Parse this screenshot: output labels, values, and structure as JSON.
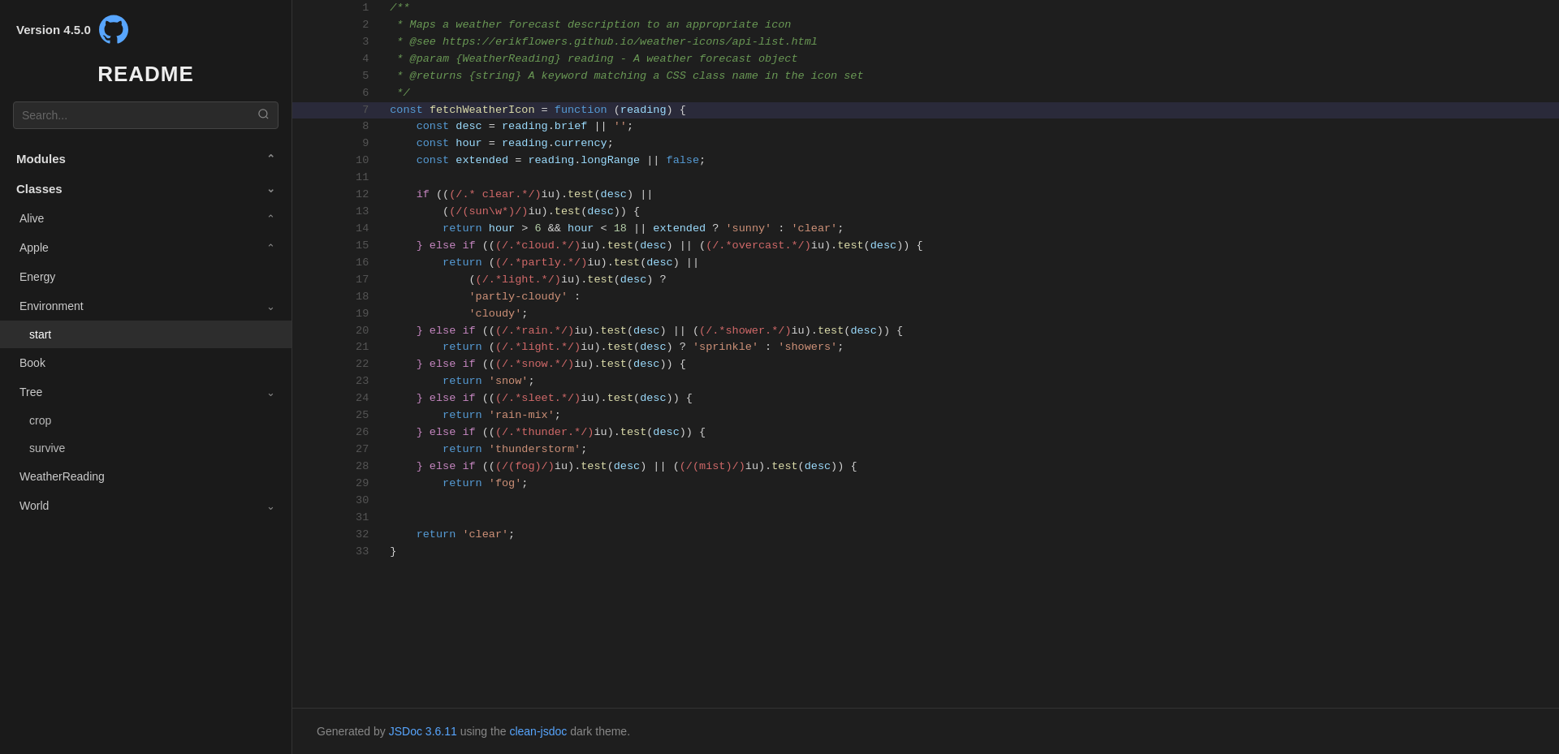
{
  "sidebar": {
    "version": "Version 4.5.0",
    "readme": "README",
    "search_placeholder": "Search...",
    "modules_label": "Modules",
    "classes_label": "Classes",
    "items": [
      {
        "label": "Alive",
        "expanded": true,
        "id": "alive"
      },
      {
        "label": "Apple",
        "expanded": true,
        "id": "apple"
      },
      {
        "label": "Energy",
        "expanded": false,
        "id": "energy"
      },
      {
        "label": "Environment",
        "expanded": false,
        "id": "environment"
      },
      {
        "label": "start",
        "expanded": false,
        "id": "start",
        "active": true
      },
      {
        "label": "Book",
        "expanded": false,
        "id": "book"
      },
      {
        "label": "Tree",
        "expanded": false,
        "id": "tree"
      },
      {
        "label": "crop",
        "expanded": false,
        "id": "crop",
        "sub": true
      },
      {
        "label": "survive",
        "expanded": false,
        "id": "survive",
        "sub": true
      },
      {
        "label": "WeatherReading",
        "expanded": false,
        "id": "weatherreading"
      },
      {
        "label": "World",
        "expanded": false,
        "id": "world"
      }
    ]
  },
  "footer": {
    "text_before": "Generated by ",
    "jsdoc_label": "JSDoc 3.6.11",
    "jsdoc_href": "#",
    "text_middle": " using the ",
    "theme_label": "clean-jsdoc",
    "theme_href": "#",
    "text_after": " dark theme."
  },
  "code": {
    "lines": [
      {
        "num": 1,
        "highlighted": false,
        "tokens": [
          {
            "t": "cm",
            "v": "/**"
          }
        ]
      },
      {
        "num": 2,
        "highlighted": false,
        "tokens": [
          {
            "t": "cm",
            "v": " * Maps a weather forecast description to an appropriate icon"
          }
        ]
      },
      {
        "num": 3,
        "highlighted": false,
        "tokens": [
          {
            "t": "cm",
            "v": " * @see https://erikflowers.github.io/weather-icons/api-list.html"
          }
        ]
      },
      {
        "num": 4,
        "highlighted": false,
        "tokens": [
          {
            "t": "cm",
            "v": " * @param {WeatherReading} reading - A weather forecast object"
          }
        ]
      },
      {
        "num": 5,
        "highlighted": false,
        "tokens": [
          {
            "t": "cm",
            "v": " * @returns {string} A keyword matching a CSS class name in the icon set"
          }
        ]
      },
      {
        "num": 6,
        "highlighted": false,
        "tokens": [
          {
            "t": "cm",
            "v": " */"
          }
        ]
      },
      {
        "num": 7,
        "highlighted": true,
        "tokens": [
          {
            "t": "kw",
            "v": "const "
          },
          {
            "t": "fn",
            "v": "fetchWeatherIcon"
          },
          {
            "t": "pn",
            "v": " = "
          },
          {
            "t": "kw",
            "v": "function "
          },
          {
            "t": "pn",
            "v": "("
          },
          {
            "t": "var",
            "v": "reading"
          },
          {
            "t": "pn",
            "v": ") {"
          }
        ]
      },
      {
        "num": 8,
        "highlighted": false,
        "tokens": [
          {
            "t": "pn",
            "v": "    "
          },
          {
            "t": "kw",
            "v": "const "
          },
          {
            "t": "var",
            "v": "desc"
          },
          {
            "t": "pn",
            "v": " = "
          },
          {
            "t": "var",
            "v": "reading"
          },
          {
            "t": "pn",
            "v": "."
          },
          {
            "t": "var",
            "v": "brief"
          },
          {
            "t": "pn",
            "v": " || "
          },
          {
            "t": "str",
            "v": "''"
          },
          {
            "t": "pn",
            "v": ";"
          }
        ]
      },
      {
        "num": 9,
        "highlighted": false,
        "tokens": [
          {
            "t": "pn",
            "v": "    "
          },
          {
            "t": "kw",
            "v": "const "
          },
          {
            "t": "var",
            "v": "hour"
          },
          {
            "t": "pn",
            "v": " = "
          },
          {
            "t": "var",
            "v": "reading"
          },
          {
            "t": "pn",
            "v": "."
          },
          {
            "t": "var",
            "v": "currency"
          },
          {
            "t": "pn",
            "v": ";"
          }
        ]
      },
      {
        "num": 10,
        "highlighted": false,
        "tokens": [
          {
            "t": "pn",
            "v": "    "
          },
          {
            "t": "kw",
            "v": "const "
          },
          {
            "t": "var",
            "v": "extended"
          },
          {
            "t": "pn",
            "v": " = "
          },
          {
            "t": "var",
            "v": "reading"
          },
          {
            "t": "pn",
            "v": "."
          },
          {
            "t": "var",
            "v": "longRange"
          },
          {
            "t": "pn",
            "v": " || "
          },
          {
            "t": "bool",
            "v": "false"
          },
          {
            "t": "pn",
            "v": ";"
          }
        ]
      },
      {
        "num": 11,
        "highlighted": false,
        "tokens": []
      },
      {
        "num": 12,
        "highlighted": false,
        "tokens": [
          {
            "t": "pn",
            "v": "    "
          },
          {
            "t": "kw2",
            "v": "if"
          },
          {
            "t": "pn",
            "v": " (("
          },
          {
            "t": "rx",
            "v": "(/.* clear.*/)"
          },
          {
            "t": "pn",
            "v": "iu)."
          },
          {
            "t": "fn",
            "v": "test"
          },
          {
            "t": "pn",
            "v": "("
          },
          {
            "t": "var",
            "v": "desc"
          },
          {
            "t": "pn",
            "v": ") ||"
          }
        ]
      },
      {
        "num": 13,
        "highlighted": false,
        "tokens": [
          {
            "t": "pn",
            "v": "        ("
          },
          {
            "t": "rx",
            "v": "(/(sun\\w*)/)"
          },
          {
            "t": "pn",
            "v": "iu)."
          },
          {
            "t": "fn",
            "v": "test"
          },
          {
            "t": "pn",
            "v": "("
          },
          {
            "t": "var",
            "v": "desc"
          },
          {
            "t": "pn",
            "v": ")) {"
          }
        ]
      },
      {
        "num": 14,
        "highlighted": false,
        "tokens": [
          {
            "t": "pn",
            "v": "        "
          },
          {
            "t": "kw",
            "v": "return "
          },
          {
            "t": "var",
            "v": "hour"
          },
          {
            "t": "pn",
            "v": " > "
          },
          {
            "t": "num",
            "v": "6"
          },
          {
            "t": "pn",
            "v": " && "
          },
          {
            "t": "var",
            "v": "hour"
          },
          {
            "t": "pn",
            "v": " < "
          },
          {
            "t": "num",
            "v": "18"
          },
          {
            "t": "pn",
            "v": " || "
          },
          {
            "t": "var",
            "v": "extended"
          },
          {
            "t": "pn",
            "v": " ? "
          },
          {
            "t": "str",
            "v": "'sunny'"
          },
          {
            "t": "pn",
            "v": " : "
          },
          {
            "t": "str",
            "v": "'clear'"
          },
          {
            "t": "pn",
            "v": ";"
          }
        ]
      },
      {
        "num": 15,
        "highlighted": false,
        "tokens": [
          {
            "t": "pn",
            "v": "    "
          },
          {
            "t": "kw2",
            "v": "} else if"
          },
          {
            "t": "pn",
            "v": " (("
          },
          {
            "t": "rx",
            "v": "(/.*cloud.*/)"
          },
          {
            "t": "pn",
            "v": "iu)."
          },
          {
            "t": "fn",
            "v": "test"
          },
          {
            "t": "pn",
            "v": "("
          },
          {
            "t": "var",
            "v": "desc"
          },
          {
            "t": "pn",
            "v": ") || ("
          },
          {
            "t": "rx",
            "v": "(/.*overcast.*/)"
          },
          {
            "t": "pn",
            "v": "iu)."
          },
          {
            "t": "fn",
            "v": "test"
          },
          {
            "t": "pn",
            "v": "("
          },
          {
            "t": "var",
            "v": "desc"
          },
          {
            "t": "pn",
            "v": ")) {"
          }
        ]
      },
      {
        "num": 16,
        "highlighted": false,
        "tokens": [
          {
            "t": "pn",
            "v": "        "
          },
          {
            "t": "kw",
            "v": "return "
          },
          {
            "t": "pn",
            "v": "("
          },
          {
            "t": "rx",
            "v": "(/.*partly.*/)"
          },
          {
            "t": "pn",
            "v": "iu)."
          },
          {
            "t": "fn",
            "v": "test"
          },
          {
            "t": "pn",
            "v": "("
          },
          {
            "t": "var",
            "v": "desc"
          },
          {
            "t": "pn",
            "v": ") ||"
          }
        ]
      },
      {
        "num": 17,
        "highlighted": false,
        "tokens": [
          {
            "t": "pn",
            "v": "            ("
          },
          {
            "t": "rx",
            "v": "(/.*light.*/)"
          },
          {
            "t": "pn",
            "v": "iu)."
          },
          {
            "t": "fn",
            "v": "test"
          },
          {
            "t": "pn",
            "v": "("
          },
          {
            "t": "var",
            "v": "desc"
          },
          {
            "t": "pn",
            "v": ") ?"
          }
        ]
      },
      {
        "num": 18,
        "highlighted": false,
        "tokens": [
          {
            "t": "pn",
            "v": "            "
          },
          {
            "t": "str",
            "v": "'partly-cloudy'"
          },
          {
            "t": "pn",
            "v": " :"
          }
        ]
      },
      {
        "num": 19,
        "highlighted": false,
        "tokens": [
          {
            "t": "pn",
            "v": "            "
          },
          {
            "t": "str",
            "v": "'cloudy'"
          },
          {
            "t": "pn",
            "v": ";"
          }
        ]
      },
      {
        "num": 20,
        "highlighted": false,
        "tokens": [
          {
            "t": "pn",
            "v": "    "
          },
          {
            "t": "kw2",
            "v": "} else if"
          },
          {
            "t": "pn",
            "v": " (("
          },
          {
            "t": "rx",
            "v": "(/.*rain.*/)"
          },
          {
            "t": "pn",
            "v": "iu)."
          },
          {
            "t": "fn",
            "v": "test"
          },
          {
            "t": "pn",
            "v": "("
          },
          {
            "t": "var",
            "v": "desc"
          },
          {
            "t": "pn",
            "v": ") || ("
          },
          {
            "t": "rx",
            "v": "(/.*shower.*/)"
          },
          {
            "t": "pn",
            "v": "iu)."
          },
          {
            "t": "fn",
            "v": "test"
          },
          {
            "t": "pn",
            "v": "("
          },
          {
            "t": "var",
            "v": "desc"
          },
          {
            "t": "pn",
            "v": ")) {"
          }
        ]
      },
      {
        "num": 21,
        "highlighted": false,
        "tokens": [
          {
            "t": "pn",
            "v": "        "
          },
          {
            "t": "kw",
            "v": "return "
          },
          {
            "t": "pn",
            "v": "("
          },
          {
            "t": "rx",
            "v": "(/.*light.*/)"
          },
          {
            "t": "pn",
            "v": "iu)."
          },
          {
            "t": "fn",
            "v": "test"
          },
          {
            "t": "pn",
            "v": "("
          },
          {
            "t": "var",
            "v": "desc"
          },
          {
            "t": "pn",
            "v": ") ? "
          },
          {
            "t": "str",
            "v": "'sprinkle'"
          },
          {
            "t": "pn",
            "v": " : "
          },
          {
            "t": "str",
            "v": "'showers'"
          },
          {
            "t": "pn",
            "v": ";"
          }
        ]
      },
      {
        "num": 22,
        "highlighted": false,
        "tokens": [
          {
            "t": "pn",
            "v": "    "
          },
          {
            "t": "kw2",
            "v": "} else if"
          },
          {
            "t": "pn",
            "v": " (("
          },
          {
            "t": "rx",
            "v": "(/.*snow.*/)"
          },
          {
            "t": "pn",
            "v": "iu)."
          },
          {
            "t": "fn",
            "v": "test"
          },
          {
            "t": "pn",
            "v": "("
          },
          {
            "t": "var",
            "v": "desc"
          },
          {
            "t": "pn",
            "v": ")) {"
          }
        ]
      },
      {
        "num": 23,
        "highlighted": false,
        "tokens": [
          {
            "t": "pn",
            "v": "        "
          },
          {
            "t": "kw",
            "v": "return "
          },
          {
            "t": "str",
            "v": "'snow'"
          },
          {
            "t": "pn",
            "v": ";"
          }
        ]
      },
      {
        "num": 24,
        "highlighted": false,
        "tokens": [
          {
            "t": "pn",
            "v": "    "
          },
          {
            "t": "kw2",
            "v": "} else if"
          },
          {
            "t": "pn",
            "v": " (("
          },
          {
            "t": "rx",
            "v": "(/.*sleet.*/)"
          },
          {
            "t": "pn",
            "v": "iu)."
          },
          {
            "t": "fn",
            "v": "test"
          },
          {
            "t": "pn",
            "v": "("
          },
          {
            "t": "var",
            "v": "desc"
          },
          {
            "t": "pn",
            "v": ")) {"
          }
        ]
      },
      {
        "num": 25,
        "highlighted": false,
        "tokens": [
          {
            "t": "pn",
            "v": "        "
          },
          {
            "t": "kw",
            "v": "return "
          },
          {
            "t": "str",
            "v": "'rain-mix'"
          },
          {
            "t": "pn",
            "v": ";"
          }
        ]
      },
      {
        "num": 26,
        "highlighted": false,
        "tokens": [
          {
            "t": "pn",
            "v": "    "
          },
          {
            "t": "kw2",
            "v": "} else if"
          },
          {
            "t": "pn",
            "v": " (("
          },
          {
            "t": "rx",
            "v": "(/.*thunder.*/)"
          },
          {
            "t": "pn",
            "v": "iu)."
          },
          {
            "t": "fn",
            "v": "test"
          },
          {
            "t": "pn",
            "v": "("
          },
          {
            "t": "var",
            "v": "desc"
          },
          {
            "t": "pn",
            "v": ")) {"
          }
        ]
      },
      {
        "num": 27,
        "highlighted": false,
        "tokens": [
          {
            "t": "pn",
            "v": "        "
          },
          {
            "t": "kw",
            "v": "return "
          },
          {
            "t": "str",
            "v": "'thunderstorm'"
          },
          {
            "t": "pn",
            "v": ";"
          }
        ]
      },
      {
        "num": 28,
        "highlighted": false,
        "tokens": [
          {
            "t": "pn",
            "v": "    "
          },
          {
            "t": "kw2",
            "v": "} else if"
          },
          {
            "t": "pn",
            "v": " (("
          },
          {
            "t": "rx",
            "v": "(/(fog)/)"
          },
          {
            "t": "pn",
            "v": "iu)."
          },
          {
            "t": "fn",
            "v": "test"
          },
          {
            "t": "pn",
            "v": "("
          },
          {
            "t": "var",
            "v": "desc"
          },
          {
            "t": "pn",
            "v": ") || ("
          },
          {
            "t": "rx",
            "v": "(/(mist)/)"
          },
          {
            "t": "pn",
            "v": "iu)."
          },
          {
            "t": "fn",
            "v": "test"
          },
          {
            "t": "pn",
            "v": "("
          },
          {
            "t": "var",
            "v": "desc"
          },
          {
            "t": "pn",
            "v": ")) {"
          }
        ]
      },
      {
        "num": 29,
        "highlighted": false,
        "tokens": [
          {
            "t": "pn",
            "v": "        "
          },
          {
            "t": "kw",
            "v": "return "
          },
          {
            "t": "str",
            "v": "'fog'"
          },
          {
            "t": "pn",
            "v": ";"
          }
        ]
      },
      {
        "num": 30,
        "highlighted": false,
        "tokens": [
          {
            "t": "pn",
            "v": "    "
          }
        ]
      },
      {
        "num": 31,
        "highlighted": false,
        "tokens": []
      },
      {
        "num": 32,
        "highlighted": false,
        "tokens": [
          {
            "t": "pn",
            "v": "    "
          },
          {
            "t": "kw",
            "v": "return "
          },
          {
            "t": "str",
            "v": "'clear'"
          },
          {
            "t": "pn",
            "v": ";"
          }
        ]
      },
      {
        "num": 33,
        "highlighted": false,
        "tokens": [
          {
            "t": "pn",
            "v": "}"
          }
        ]
      }
    ]
  }
}
